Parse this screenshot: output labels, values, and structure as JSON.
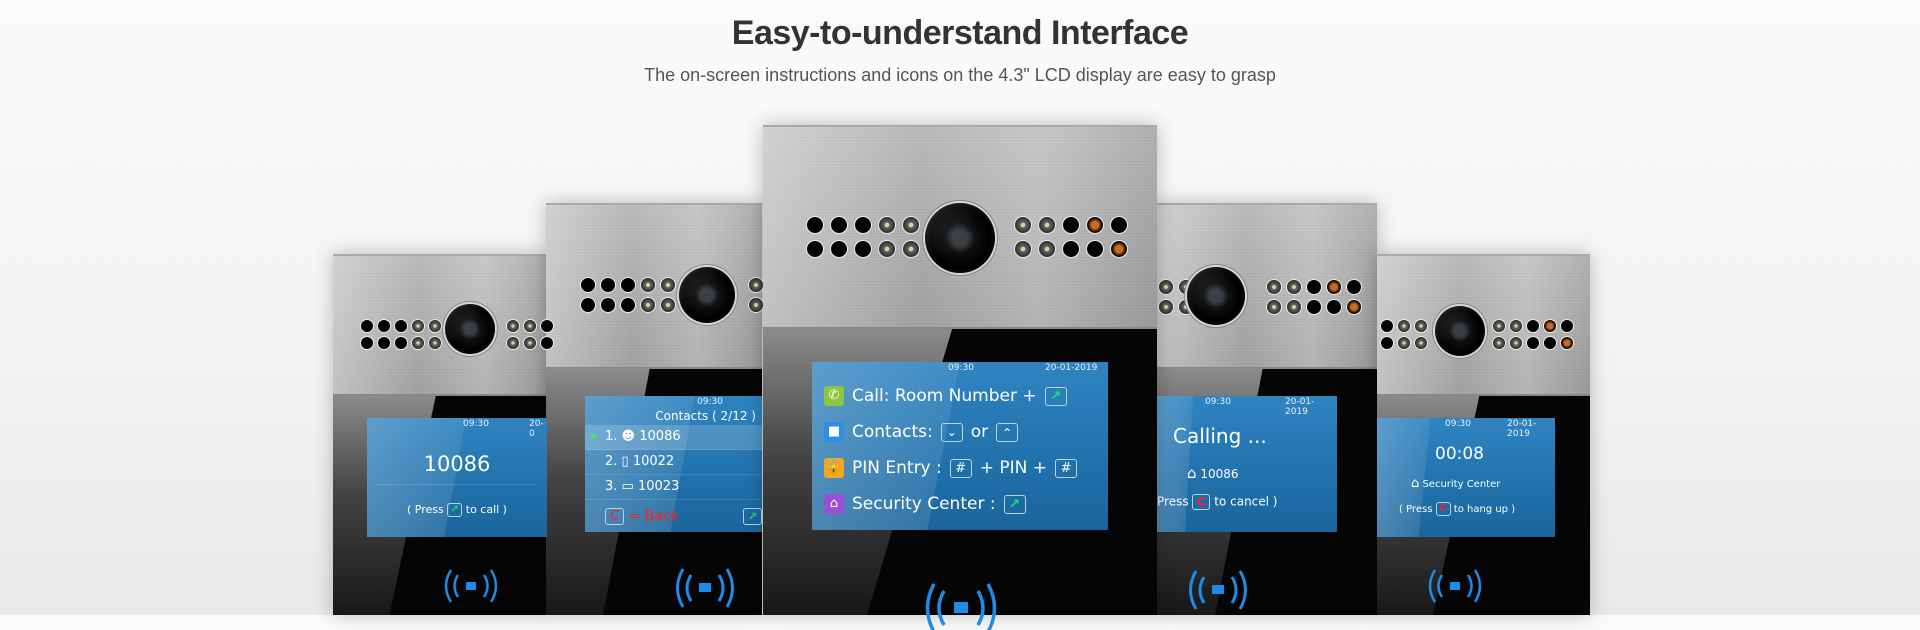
{
  "header": {
    "title": "Easy-to-understand Interface",
    "subtitle": "The on-screen instructions and icons on the 4.3\" LCD display are easy to grasp"
  },
  "colors": {
    "screen_blue": "#2f84c0",
    "call_green": "#22e06a",
    "cancel_red": "#ff2020",
    "nfc_blue": "#1e8be6",
    "icon_call": "#8dc63f",
    "icon_contacts": "#2e8fe6",
    "icon_pin": "#f5a623",
    "icon_security": "#9b4fd9"
  },
  "devices": [
    {
      "name": "dial-screen",
      "status": {
        "time": "09:30",
        "date": "20-0"
      },
      "number": "10086",
      "hint_prefix": "( Press",
      "hint_key": "phone-key",
      "hint_suffix": "to call )"
    },
    {
      "name": "contacts-screen",
      "status": {
        "time": "09:30"
      },
      "header": "Contacts ( 2/12 )",
      "items": [
        {
          "index": "1.",
          "icon": "person-icon",
          "number": "10086",
          "selected": true
        },
        {
          "index": "2.",
          "icon": "mobile-icon",
          "number": "10022",
          "selected": false
        },
        {
          "index": "3.",
          "icon": "monitor-icon",
          "number": "10023",
          "selected": false
        }
      ],
      "back_key": "C",
      "back_label": "= Back"
    },
    {
      "name": "main-menu-screen",
      "status": {
        "time": "09:30",
        "date": "20-01-2019"
      },
      "rows": [
        {
          "icon": "call-icon",
          "label": "Call: Room Number +",
          "keys": [
            "phone"
          ]
        },
        {
          "icon": "contacts-icon",
          "label": "Contacts:",
          "keys": [
            "down",
            "or",
            "up"
          ]
        },
        {
          "icon": "pin-lock-icon",
          "label": "PIN Entry :",
          "keys": [
            "#",
            "+ PIN +",
            "#"
          ]
        },
        {
          "icon": "security-center-icon",
          "label": "Security Center :",
          "keys": [
            "phone"
          ]
        }
      ]
    },
    {
      "name": "calling-screen",
      "status": {
        "time": "09:30",
        "date": "20-01-2019"
      },
      "title": "Calling ...",
      "target_icon": "house-icon",
      "target": "10086",
      "hint_prefix": "Press",
      "hint_key": "C",
      "hint_suffix": "to cancel )"
    },
    {
      "name": "in-call-screen",
      "status": {
        "time": "09:30",
        "date": "20-01-2019"
      },
      "timer": "00:08",
      "target_icon": "security-house-icon",
      "target": "Security Center",
      "hint_prefix": "( Press",
      "hint_key": "C",
      "hint_suffix": "to hang up )"
    }
  ]
}
